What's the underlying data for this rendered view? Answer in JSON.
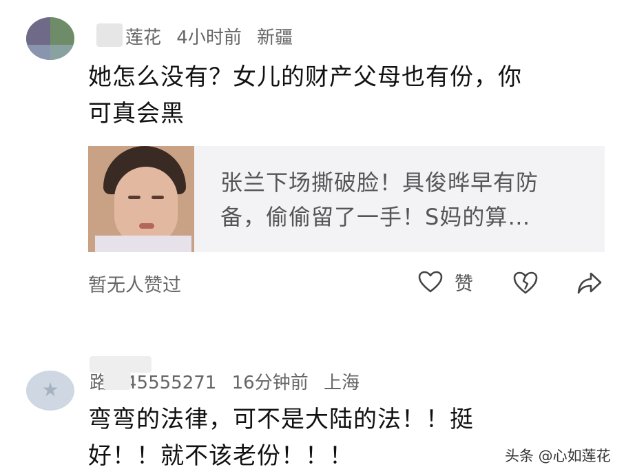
{
  "comments": [
    {
      "username": "莲花",
      "time": "4小时前",
      "location": "新疆",
      "text_line1": "她怎么没有？女儿的财产父母也有份，你",
      "text_line2": "可真会黑",
      "card": {
        "title_line1": "张兰下场撕破脸！具俊晔早有防",
        "title_line2": "备，偷偷留了一手！S妈的算…"
      },
      "no_likes": "暂无人赞过",
      "like_label": "赞"
    },
    {
      "username": "路人45555271",
      "time": "16分钟前",
      "location": "上海",
      "text_line1": "弯弯的法律，可不是大陆的法！！挺",
      "text_line2": "好！！就不该老份！！！"
    }
  ],
  "watermark": "头条 @心如莲花",
  "icons": [
    "heart-outline-icon",
    "broken-heart-icon",
    "share-arrow-icon"
  ]
}
